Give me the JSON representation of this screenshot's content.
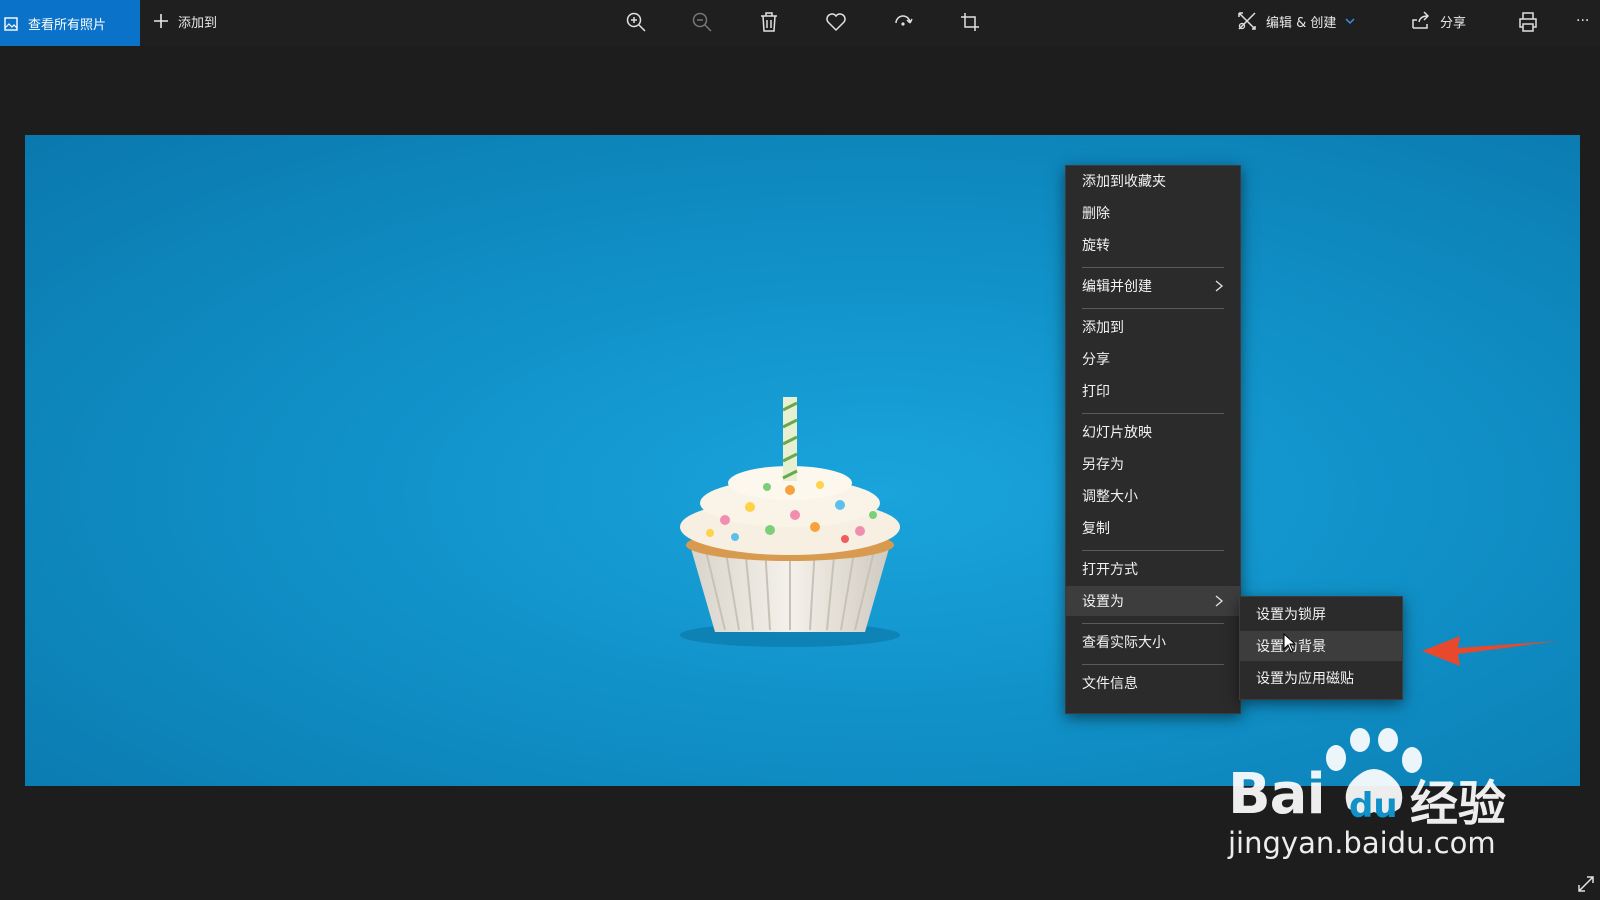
{
  "toolbar": {
    "view_all_label": "查看所有照片",
    "add_to_label": "添加到",
    "edit_create_label": "编辑 & 创建",
    "share_label": "分享",
    "more_label": "···"
  },
  "context_menu": {
    "items": [
      {
        "label": "添加到收藏夹"
      },
      {
        "label": "删除"
      },
      {
        "label": "旋转"
      },
      {
        "label": "编辑并创建",
        "has_submenu": true
      },
      {
        "label": "添加到"
      },
      {
        "label": "分享"
      },
      {
        "label": "打印"
      },
      {
        "label": "幻灯片放映"
      },
      {
        "label": "另存为"
      },
      {
        "label": "调整大小"
      },
      {
        "label": "复制"
      },
      {
        "label": "打开方式"
      },
      {
        "label": "设置为",
        "has_submenu": true,
        "highlighted": true
      },
      {
        "label": "查看实际大小"
      },
      {
        "label": "文件信息"
      }
    ]
  },
  "submenu": {
    "items": [
      {
        "label": "设置为锁屏"
      },
      {
        "label": "设置为背景",
        "highlighted": true
      },
      {
        "label": "设置为应用磁贴"
      }
    ]
  },
  "watermark": {
    "brand_main": "Bai",
    "brand_du": "du",
    "brand_cn": "经验",
    "url": "jingyan.baidu.com"
  },
  "colors": {
    "accent": "#0a72c8",
    "photo_bg": "#1091c8",
    "menu_bg": "#2b2b2b",
    "arrow": "#e8492d"
  }
}
